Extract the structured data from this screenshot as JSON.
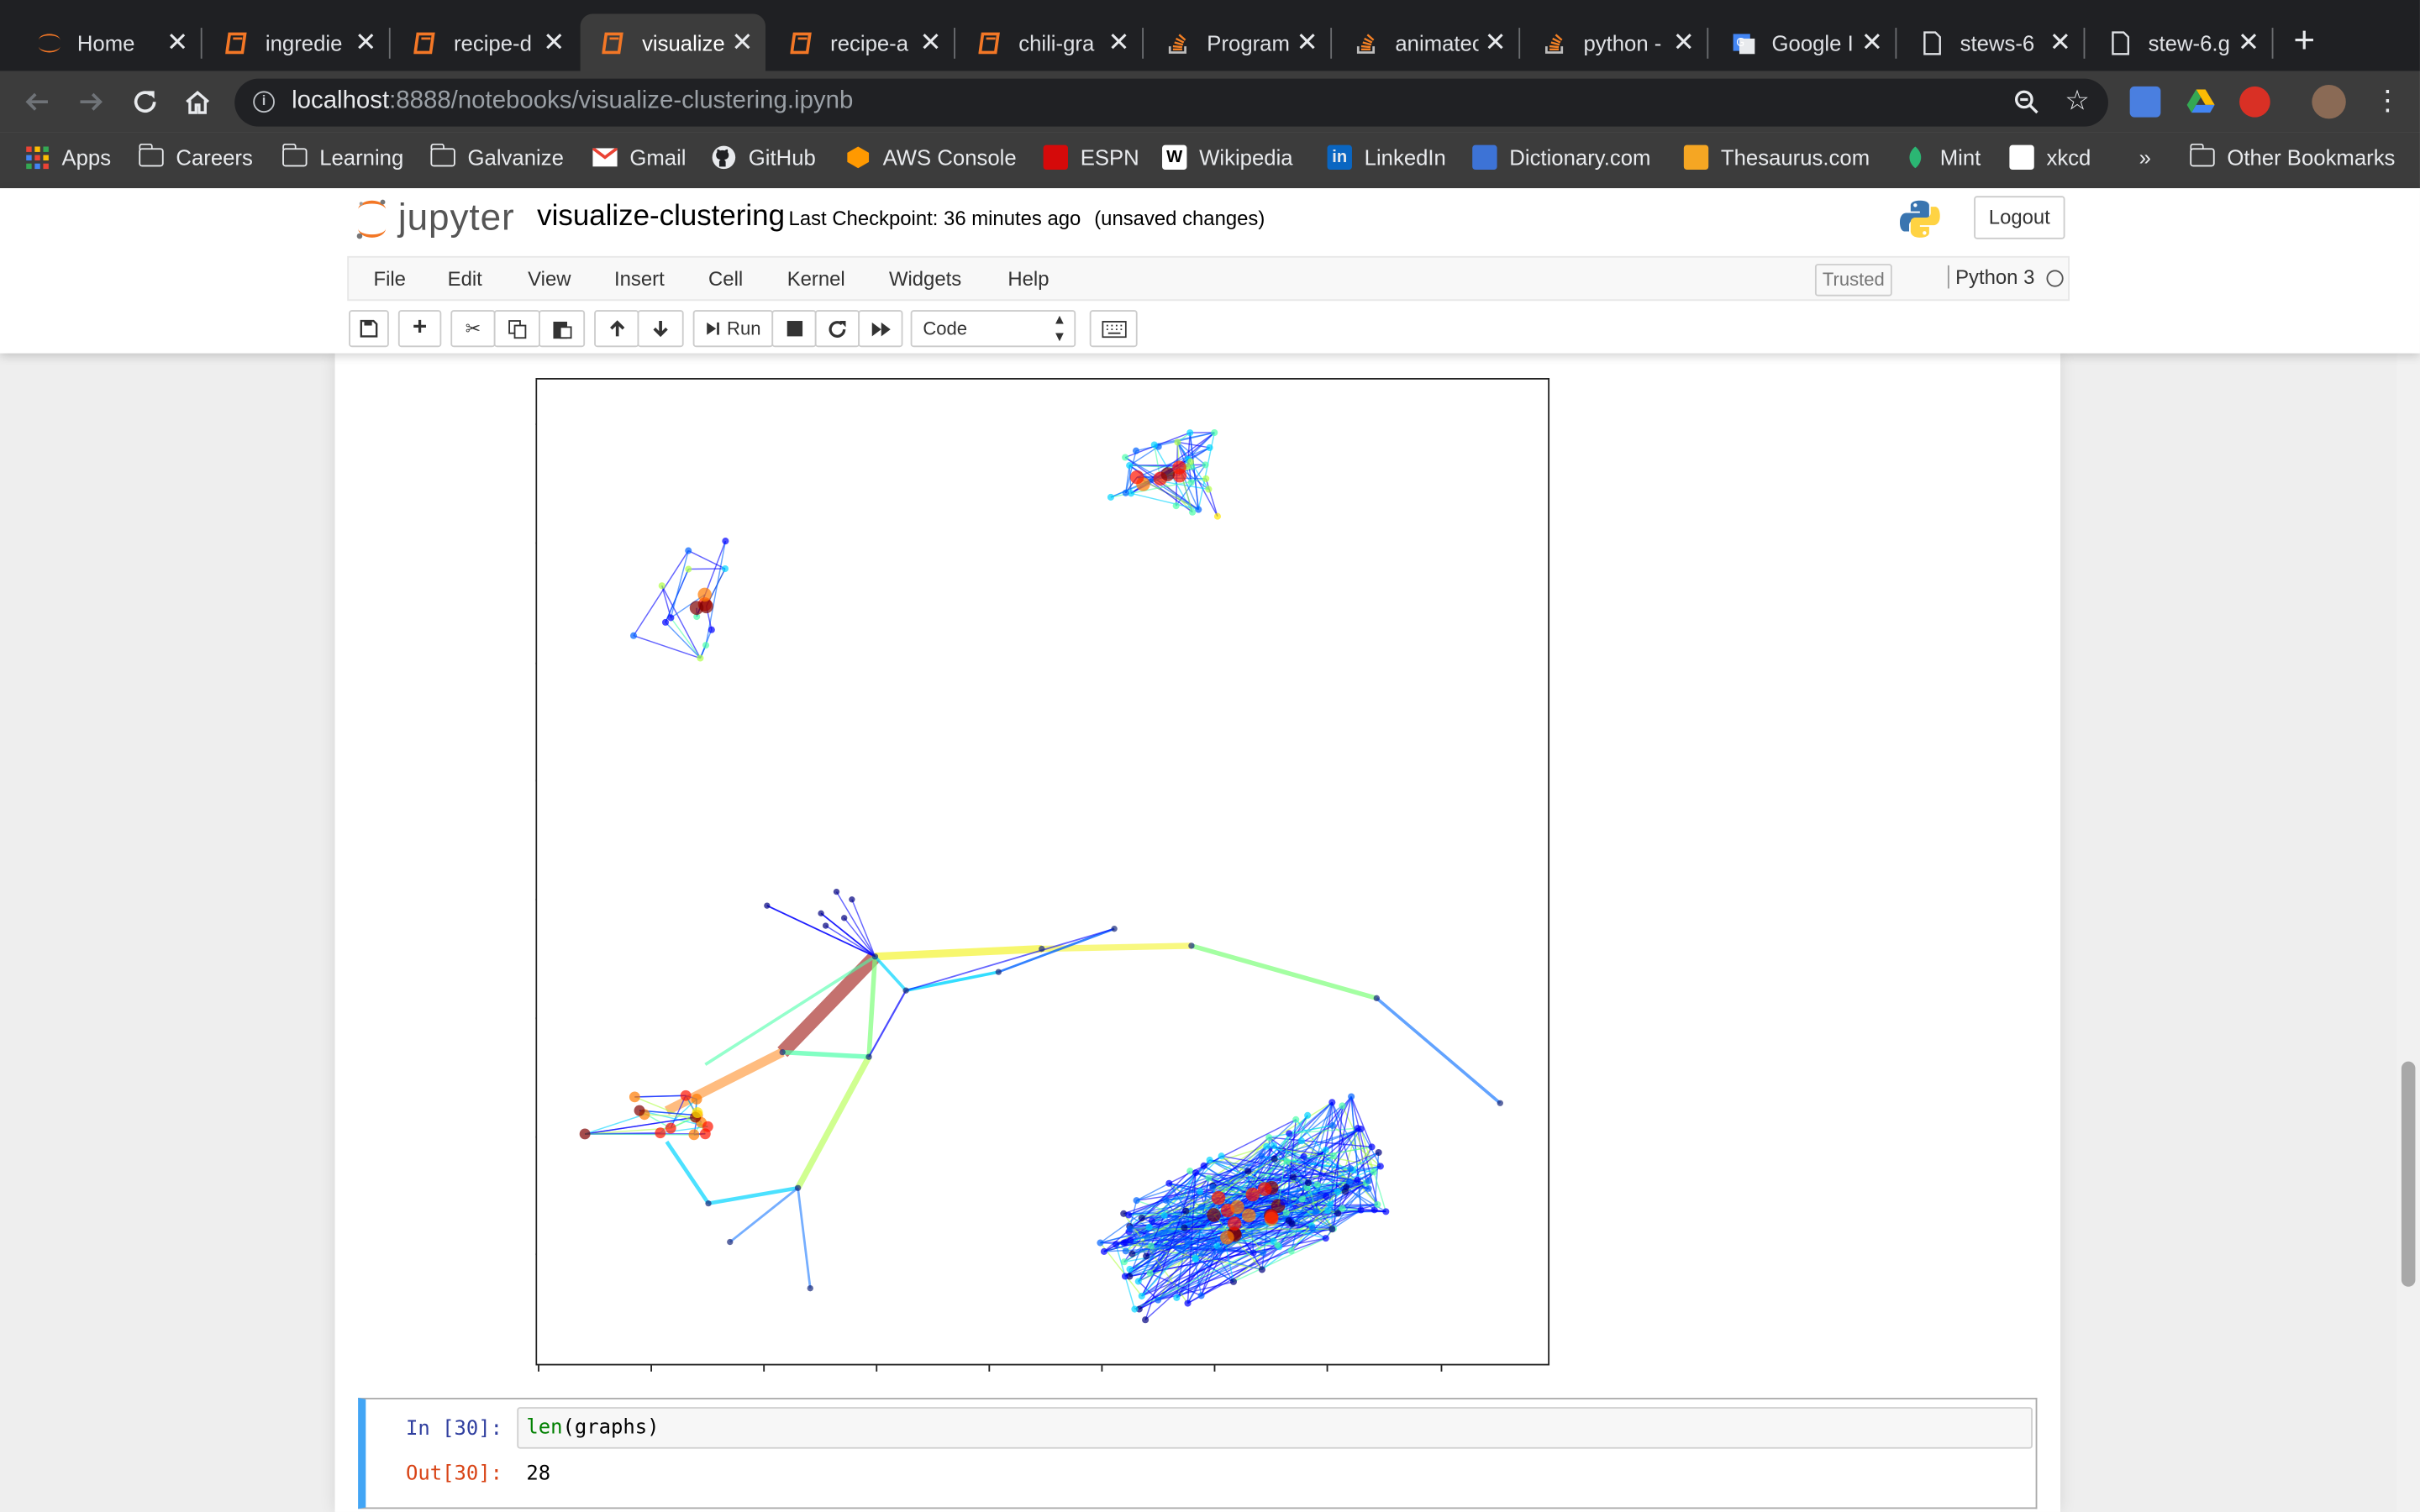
{
  "browser": {
    "tabs": [
      {
        "title": "Home",
        "icon": "jupyter-icon"
      },
      {
        "title": "ingredie",
        "icon": "notebook-icon"
      },
      {
        "title": "recipe-d",
        "icon": "notebook-icon"
      },
      {
        "title": "visualize",
        "icon": "notebook-icon"
      },
      {
        "title": "recipe-a",
        "icon": "notebook-icon"
      },
      {
        "title": "chili-gra",
        "icon": "notebook-icon"
      },
      {
        "title": "Program",
        "icon": "stackoverflow-icon"
      },
      {
        "title": "animatec",
        "icon": "stackoverflow-icon"
      },
      {
        "title": "python -",
        "icon": "stackoverflow-icon"
      },
      {
        "title": "Google I",
        "icon": "google-translate-icon"
      },
      {
        "title": "stews-6",
        "icon": "file-icon"
      },
      {
        "title": "stew-6.g",
        "icon": "file-icon"
      }
    ],
    "url_host": "localhost",
    "url_rest": ":8888/notebooks/visualize-clustering.ipynb",
    "bookmarks": [
      {
        "label": "Apps",
        "icon": "apps-grid-icon"
      },
      {
        "label": "Careers",
        "icon": "folder-icon"
      },
      {
        "label": "Learning",
        "icon": "folder-icon"
      },
      {
        "label": "Galvanize",
        "icon": "folder-icon"
      },
      {
        "label": "Gmail",
        "icon": "gmail-icon"
      },
      {
        "label": "GitHub",
        "icon": "github-icon"
      },
      {
        "label": "AWS Console",
        "icon": "aws-icon"
      },
      {
        "label": "ESPN",
        "icon": "espn-icon"
      },
      {
        "label": "Wikipedia",
        "icon": "wikipedia-icon"
      },
      {
        "label": "LinkedIn",
        "icon": "linkedin-icon"
      },
      {
        "label": "Dictionary.com",
        "icon": "dictionary-icon"
      },
      {
        "label": "Thesaurus.com",
        "icon": "thesaurus-icon"
      },
      {
        "label": "Mint",
        "icon": "mint-icon"
      },
      {
        "label": "xkcd",
        "icon": "xkcd-icon"
      }
    ],
    "overflow_label": "»",
    "other_bookmarks": "Other Bookmarks"
  },
  "jupyter": {
    "logo_text": "jupyter",
    "notebook_name": "visualize-clustering",
    "checkpoint": "Last Checkpoint: 36 minutes ago",
    "unsaved": "(unsaved changes)",
    "logout": "Logout",
    "menu": [
      "File",
      "Edit",
      "View",
      "Insert",
      "Cell",
      "Kernel",
      "Widgets",
      "Help"
    ],
    "trusted": "Trusted",
    "kernel": "Python 3",
    "run_label": "Run",
    "cell_type": "Code"
  },
  "cell": {
    "in_prompt": "In [30]:",
    "code_fn": "len",
    "code_arg": "graphs",
    "out_prompt": "Out[30]:",
    "output": "28"
  },
  "colors": {
    "accent": "#42a5f5",
    "in_prompt": "#303f9f",
    "out_prompt": "#d84315",
    "jupyter_orange": "#f37726"
  },
  "chart_data": {
    "type": "network-graph",
    "description_visible": "force-directed layout of several node clusters with jet-colormap edges and nodes",
    "axes": {
      "x_ticks": 9,
      "y_ticks": 8,
      "tick_labels": false
    }
  }
}
